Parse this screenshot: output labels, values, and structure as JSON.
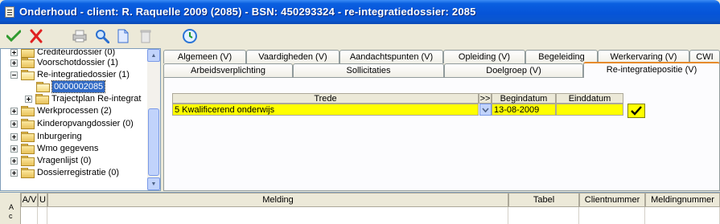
{
  "window": {
    "title": "Onderhoud - client:  R. Raquelle 2009 (2085) - BSN: 450293324 - re-integratiedossier: 2085"
  },
  "toolbar": {
    "buttons": [
      {
        "name": "save",
        "icon": "checkmark-icon"
      },
      {
        "name": "cancel",
        "icon": "red-x-icon"
      },
      {
        "name": "print",
        "icon": "printer-icon"
      },
      {
        "name": "search",
        "icon": "magnifier-icon"
      },
      {
        "name": "new",
        "icon": "document-icon"
      },
      {
        "name": "delete",
        "icon": "trash-icon"
      },
      {
        "name": "history",
        "icon": "clock-refresh-icon"
      }
    ]
  },
  "tree": {
    "items": [
      {
        "label": "Crediteurdossier (0)",
        "level": 0,
        "expander": "plus"
      },
      {
        "label": "Voorschotdossier (1)",
        "level": 0,
        "expander": "plus"
      },
      {
        "label": "Re-integratiedossier (1)",
        "level": 0,
        "expander": "minus"
      },
      {
        "label": "0000002085",
        "level": 1,
        "expander": "none",
        "selected": true
      },
      {
        "label": "Trajectplan Re-integrat",
        "level": 1,
        "expander": "plus"
      },
      {
        "label": "Werkprocessen (2)",
        "level": 0,
        "expander": "plus"
      },
      {
        "label": "Kinderopvangdossier (0)",
        "level": 0,
        "expander": "plus"
      },
      {
        "label": "Inburgering",
        "level": 0,
        "expander": "plus"
      },
      {
        "label": "Wmo gegevens",
        "level": 0,
        "expander": "plus"
      },
      {
        "label": "Vragenlijst (0)",
        "level": 0,
        "expander": "plus"
      },
      {
        "label": "Dossierregistratie (0)",
        "level": 0,
        "expander": "plus"
      }
    ]
  },
  "tabs": {
    "row1": [
      "Algemeen (V)",
      "Vaardigheden (V)",
      "Aandachtspunten (V)",
      "Opleiding (V)",
      "Begeleiding",
      "Werkervaring (V)",
      "CWI"
    ],
    "row2": [
      "Arbeidsverplichting",
      "Sollicitaties",
      "Doelgroep (V)",
      "Re-integratiepositie (V)"
    ],
    "active": "Re-integratiepositie (V)"
  },
  "grid": {
    "headers": {
      "trede": "Trede",
      "more": ">>",
      "begindatum": "Begindatum",
      "einddatum": "Einddatum"
    },
    "row": {
      "trede": "5 Kwalificerend onderwijs",
      "begindatum": "13-08-2009",
      "einddatum": ""
    },
    "highlight_color": "#ffff00"
  },
  "messages": {
    "headers": {
      "av": "A/V",
      "u": "U",
      "melding": "Melding",
      "tabel": "Tabel",
      "clientnummer": "Clientnummer",
      "meldingnummer": "Meldingnummer"
    },
    "row_marker_lines": [
      "A",
      "c"
    ]
  }
}
